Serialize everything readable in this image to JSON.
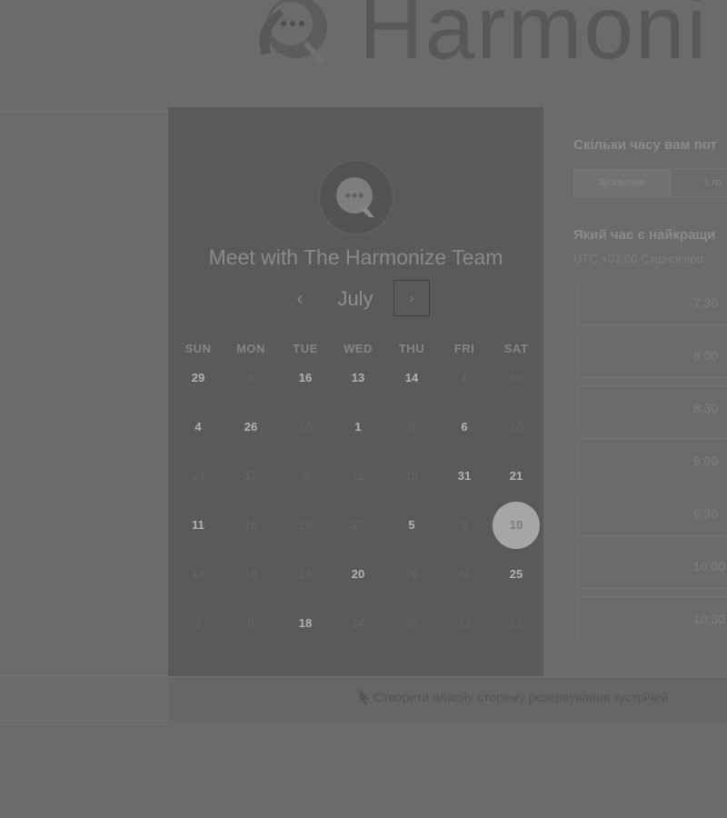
{
  "brand": {
    "name": "Harmoni"
  },
  "calendar": {
    "title": "Meet with The Harmonize Team",
    "month": "July",
    "prev_label": "‹",
    "next_label": "›",
    "weekdays": [
      "SUN",
      "MON",
      "TUE",
      "WED",
      "THU",
      "FRI",
      "SAT"
    ],
    "weeks": [
      [
        {
          "d": "29",
          "a": true
        },
        {
          "d": "4",
          "a": false
        },
        {
          "d": "16",
          "a": true
        },
        {
          "d": "13",
          "a": true
        },
        {
          "d": "14",
          "a": true
        },
        {
          "d": "1",
          "a": false
        },
        {
          "d": "30",
          "a": false
        }
      ],
      [
        {
          "d": "4",
          "a": true
        },
        {
          "d": "26",
          "a": true
        },
        {
          "d": "10",
          "a": false
        },
        {
          "d": "1",
          "a": true
        },
        {
          "d": "8",
          "a": false
        },
        {
          "d": "6",
          "a": true
        },
        {
          "d": "20",
          "a": false
        }
      ],
      [
        {
          "d": "24",
          "a": false
        },
        {
          "d": "17",
          "a": false
        },
        {
          "d": "3",
          "a": false
        },
        {
          "d": "11",
          "a": false
        },
        {
          "d": "19",
          "a": false
        },
        {
          "d": "31",
          "a": true
        },
        {
          "d": "21",
          "a": true
        }
      ],
      [
        {
          "d": "11",
          "a": true
        },
        {
          "d": "16",
          "a": false
        },
        {
          "d": "20",
          "a": false
        },
        {
          "d": "27",
          "a": false
        },
        {
          "d": "5",
          "a": true
        },
        {
          "d": "8",
          "a": false
        },
        {
          "d": "10",
          "a": true,
          "selected": true
        }
      ],
      [
        {
          "d": "18",
          "a": false
        },
        {
          "d": "18",
          "a": false
        },
        {
          "d": "16",
          "a": false
        },
        {
          "d": "20",
          "a": true
        },
        {
          "d": "26",
          "a": false
        },
        {
          "d": "31",
          "a": false
        },
        {
          "d": "25",
          "a": true
        }
      ],
      [
        {
          "d": "3",
          "a": false
        },
        {
          "d": "9",
          "a": false
        },
        {
          "d": "18",
          "a": true
        },
        {
          "d": "24",
          "a": false
        },
        {
          "d": "30",
          "a": false
        },
        {
          "d": "13",
          "a": false
        },
        {
          "d": "21",
          "a": false
        }
      ]
    ]
  },
  "booking": {
    "duration_question": "Скільки часу вам пот",
    "durations": [
      "30 хвилин",
      "1 го"
    ],
    "time_question": "Який час є найкращи",
    "timezone": "UTC +03:00 Східноєвро",
    "slots": [
      "7:30",
      "8:00",
      "8:30",
      "9:00",
      "9:30",
      "10:00",
      "10:30"
    ]
  },
  "footer": {
    "link": "Створити власну сторінку резервування зустрічей"
  },
  "colors": {
    "overlay_bg": "#6b6b6b",
    "card_bg": "#5a5a5a",
    "selected_day": "#a6a6a6"
  }
}
